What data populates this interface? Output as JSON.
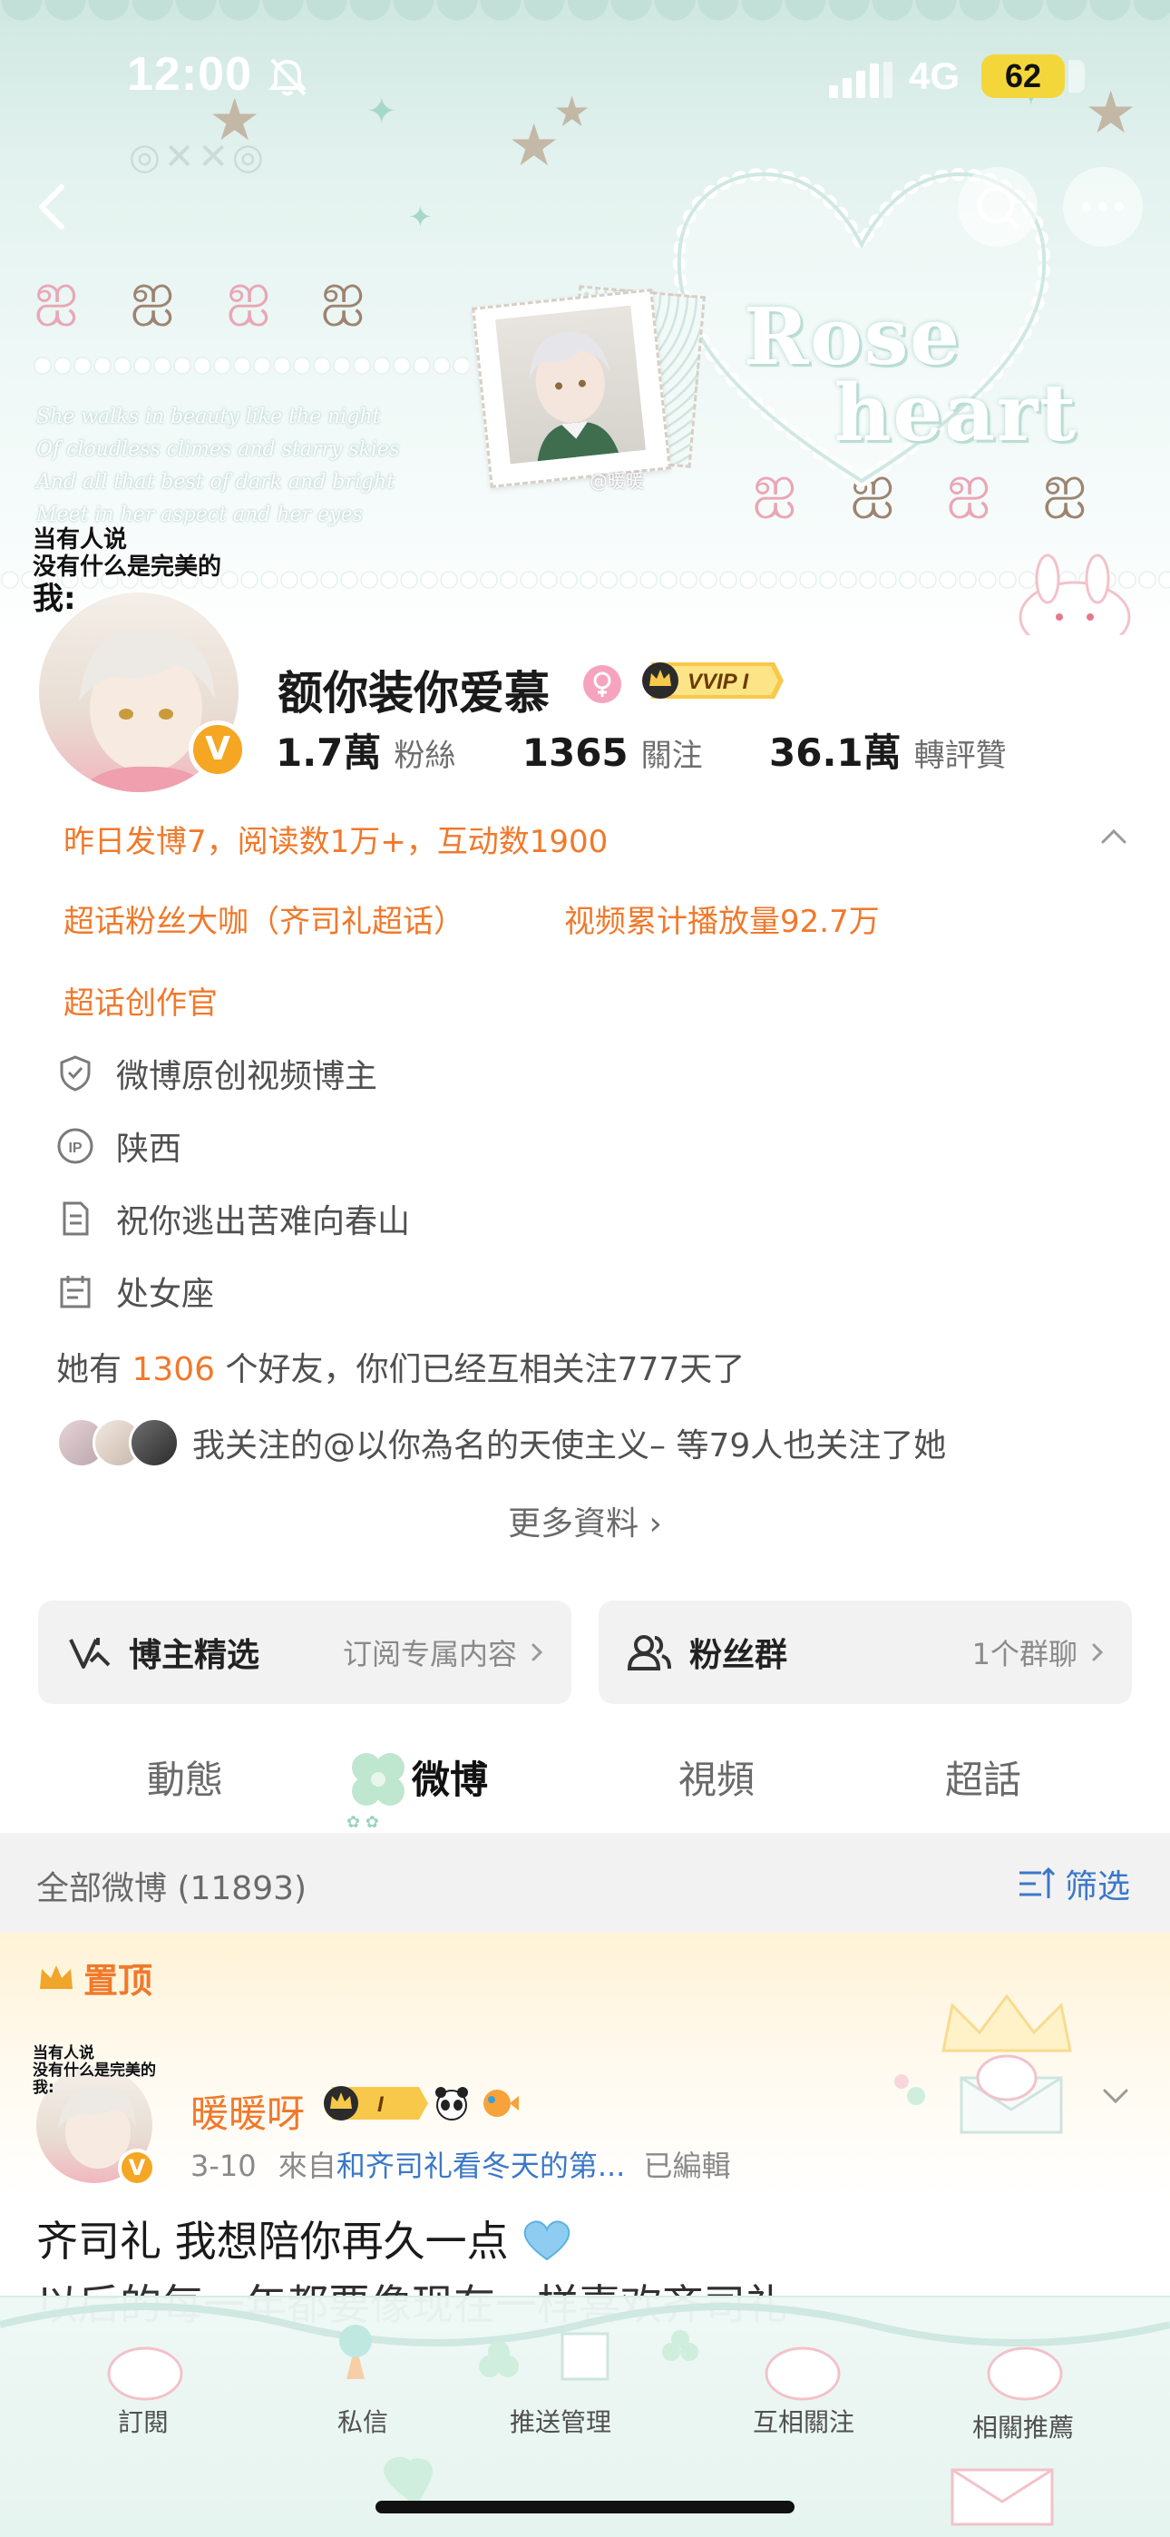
{
  "status_bar": {
    "time": "12:00",
    "network": "4G",
    "battery": "62"
  },
  "banner": {
    "poem_lines": [
      "She walks in beauty like the night",
      "Of cloudless climes and starry skies",
      "And all that best of dark and bright",
      "Meet in her aspect and her eyes"
    ],
    "rose_text_line1": "Rose",
    "rose_text_line2": "heart",
    "stamp_caption": "@暖暖"
  },
  "profile": {
    "avatar_caption_line1": "当有人说",
    "avatar_caption_line2": "没有什么是完美的",
    "avatar_caption_line3": "我:",
    "username": "额你装你爱慕",
    "vvip_label": "VVIP I",
    "verified_badge": "V",
    "stats": [
      {
        "value": "1.7萬",
        "label": "粉絲"
      },
      {
        "value": "1365",
        "label": "關注"
      },
      {
        "value": "36.1萬",
        "label": "轉評贊"
      }
    ]
  },
  "highlights": {
    "line1": "昨日发博7，阅读数1万+，互动数1900",
    "tag_a": "超话粉丝大咖（齐司礼超话）",
    "tag_b": "视频累计播放量92.7万",
    "tag_c": "超话创作官"
  },
  "info": [
    {
      "icon": "shield-icon",
      "text": "微博原创视频博主"
    },
    {
      "icon": "ip-location-icon",
      "text": "陕西"
    },
    {
      "icon": "document-icon",
      "text": "祝你逃出苦难向春山"
    },
    {
      "icon": "calendar-icon",
      "text": "处女座"
    }
  ],
  "friends": {
    "prefix": "她有",
    "count": "1306",
    "suffix": "个好友，你们已经互相关注777天了"
  },
  "mutual": {
    "text": "我关注的@以你為名的天使主义– 等79人也关注了她"
  },
  "more_info": "更多資料 ›",
  "cards": {
    "left": {
      "title": "博主精选",
      "subtitle": "订阅专属内容"
    },
    "right": {
      "title": "粉丝群",
      "subtitle": "1个群聊"
    }
  },
  "tabs": [
    "動態",
    "微博",
    "視頻",
    "超話"
  ],
  "active_tab": "微博",
  "filter_bar": {
    "count": "全部微博 (11893)",
    "filter_label": "筛选"
  },
  "pinned_post": {
    "pin_label": "置顶",
    "author": "暖暖呀",
    "avatar_caption_line1": "当有人说",
    "avatar_caption_line2": "没有什么是完美的",
    "avatar_caption_line3": "我:",
    "verified_badge": "V",
    "date": "3-10",
    "source_prefix": "來自",
    "source": "和齐司礼看冬天的第...",
    "edited": "已編輯",
    "badge_level": "I",
    "text_line1": "齐司礼 我想陪你再久一点",
    "text_line2": "以后的每一年都要像现在一样喜欢齐司礼"
  },
  "bottom_bar": [
    "訂閱",
    "私信",
    "推送管理",
    "互相關注",
    "相關推薦"
  ],
  "colors": {
    "accent_orange": "#f0792b",
    "link_blue": "#3a78c8",
    "vip_gold": "#f5a623",
    "banner_mint": "#cfe7e1"
  }
}
